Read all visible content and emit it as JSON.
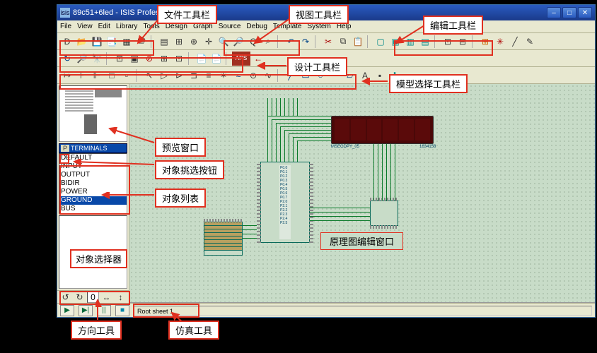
{
  "window": {
    "title_prefix": "isis",
    "title": "89c51+6led - ISIS Professional",
    "app_icon": "isis"
  },
  "win_buttons": {
    "min": "–",
    "max": "□",
    "close": "✕"
  },
  "menubar": [
    "File",
    "View",
    "Edit",
    "Library",
    "Tools",
    "Design",
    "Graph",
    "Source",
    "Debug",
    "Template",
    "System",
    "Help"
  ],
  "toolbar_file": {
    "new": "D",
    "open": "📂",
    "save": "💾",
    "import": "📑",
    "area": "▦",
    "print": "🖶",
    "mark": "▤",
    "grid": "⊞",
    "origin": "⊕",
    "center": "✛",
    "zoom_in": "🔍",
    "zoom_out": "🔎",
    "zoom_all": "Q",
    "zoom_area": "⌕",
    "undo": "↶",
    "redo": "↷",
    "cut": "✂",
    "copy": "⧉",
    "paste": "📋",
    "block": "▢",
    "move": "▣",
    "rotate": "▥",
    "delete": "▤",
    "pick": "⊡",
    "lib": "⊟",
    "wire": "⊞",
    "decomp": "✳",
    "dash": "╱",
    "prop": "✎"
  },
  "toolbar_design": {
    "redo2": "↻",
    "find": "🔎",
    "binoc": "🔭",
    "tool1": "⊡",
    "tool2": "▣",
    "cancel": "⊘",
    "tool3": "⊞",
    "tool4": "⊡",
    "export": "📄",
    "import2": "📄",
    "erc": "ARS",
    "arrow": "←"
  },
  "toolbar_model": {
    "t1": "↦",
    "t2": "⊦",
    "t3": "⊩",
    "t4": "□",
    "t5": "▫",
    "arrow": "↖",
    "t6": "▷",
    "t7": "⊳",
    "t8": "⊐",
    "t9": "≡",
    "t10": "✶",
    "t11": "≈",
    "t12": "⊙",
    "t13": "∿",
    "line": "╱",
    "rect": "▭",
    "circ": "○",
    "arc": "⌒",
    "poly": "▱",
    "text": "A",
    "sym": "▪",
    "plus": "✚"
  },
  "picker": {
    "header_p": "P",
    "header": "TERMINALS"
  },
  "objlist": [
    "DEFAULT",
    "INPUT",
    "OUTPUT",
    "BIDIR",
    "POWER",
    "GROUND",
    "BUS"
  ],
  "objlist_selected": 5,
  "orientation": {
    "ccw": "↺",
    "cw": "↻",
    "angle": "0",
    "flip_h": "↔",
    "flip_v": "↕"
  },
  "simulation": {
    "play": "▶",
    "step": "▶|",
    "pause": "||",
    "stop": "■"
  },
  "status": {
    "sheet": "Root sheet 1"
  },
  "seg_display": {
    "label_left": "MSEGDPY_05",
    "label_right": "1634158"
  },
  "callouts": {
    "file_toolbar": "文件工具栏",
    "view_toolbar": "视图工具栏",
    "edit_toolbar": "编辑工具栏",
    "design_toolbar": "设计工具栏",
    "model_toolbar": "模型选择工具栏",
    "preview_window": "预览窗口",
    "pick_button": "对象挑选按钮",
    "object_list": "对象列表",
    "object_selector": "对象选择器",
    "schematic_window": "原理图编辑窗口",
    "orient_tools": "方向工具",
    "sim_tools": "仿真工具"
  }
}
